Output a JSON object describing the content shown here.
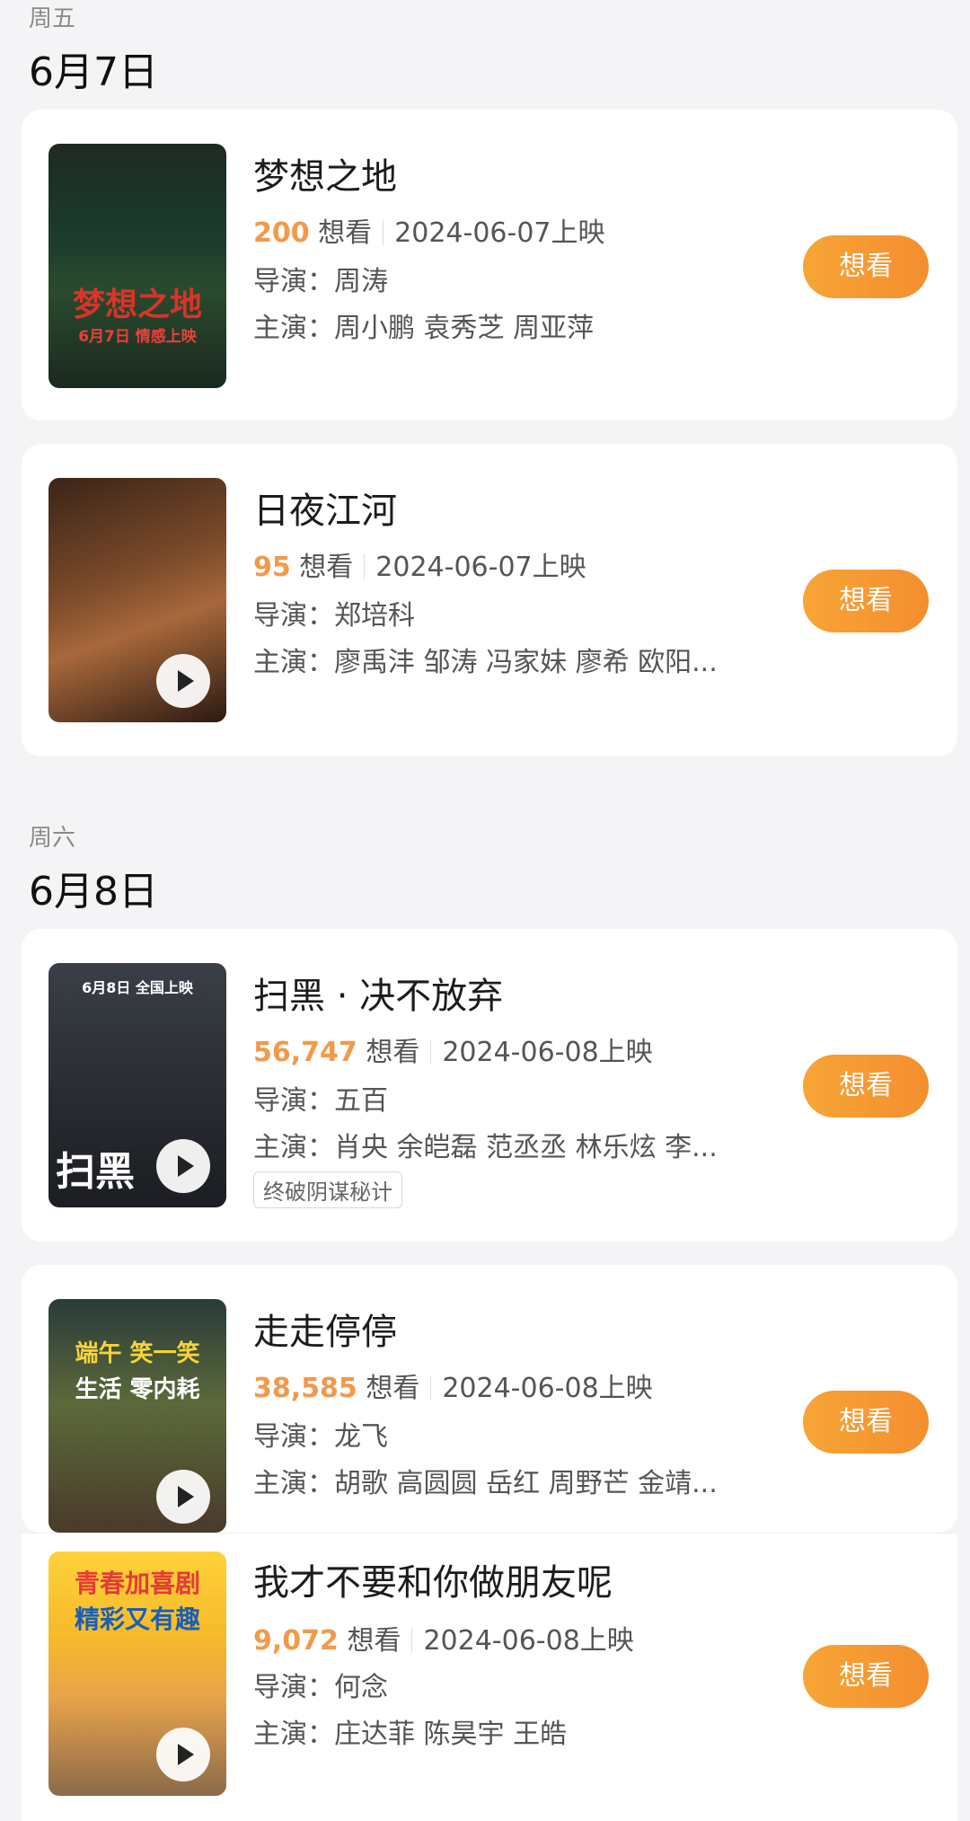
{
  "sections": [
    {
      "weekday": "周五",
      "date": "6月7日",
      "movies": [
        {
          "title": "梦想之地",
          "want_count": "200",
          "want_label": "想看",
          "release": "2024-06-07上映",
          "director": "导演：周涛",
          "cast": "主演：周小鹏 袁秀芝 周亚萍",
          "button": "想看",
          "poster_text": "梦想之地",
          "poster_sub": "6月7日 情感上映"
        },
        {
          "title": "日夜江河",
          "want_count": "95",
          "want_label": "想看",
          "release": "2024-06-07上映",
          "director": "导演：郑培科",
          "cast": "主演：廖禹沣 邹涛 冯家妹 廖希 欧阳...",
          "button": "想看"
        }
      ]
    },
    {
      "weekday": "周六",
      "date": "6月8日",
      "movies": [
        {
          "title": "扫黑 · 决不放弃",
          "want_count": "56,747",
          "want_label": "想看",
          "release": "2024-06-08上映",
          "director": "导演：五百",
          "cast": "主演：肖央 余皑磊 范丞丞 林乐炫 李...",
          "tag": "终破阴谋秘计",
          "button": "想看",
          "poster_text": "扫黑",
          "poster_sub": "6月8日 全国上映"
        },
        {
          "title": "走走停停",
          "want_count": "38,585",
          "want_label": "想看",
          "release": "2024-06-08上映",
          "director": "导演：龙飞",
          "cast": "主演：胡歌 高圆圆 岳红 周野芒 金靖...",
          "button": "想看",
          "poster_text": "端午 笑一笑",
          "poster_sub": "生活 零内耗"
        },
        {
          "title": "我才不要和你做朋友呢",
          "want_count": "9,072",
          "want_label": "想看",
          "release": "2024-06-08上映",
          "director": "导演：何念",
          "cast": "主演：庄达菲 陈昊宇 王皓",
          "button": "想看",
          "poster_text": "青春加喜剧",
          "poster_sub": "精彩又有趣"
        }
      ]
    }
  ],
  "colors": {
    "accent": "#f2994a",
    "button_gradient": [
      "#f7a536",
      "#f48e2f"
    ],
    "background": "#f4f4f6"
  },
  "icons": [
    "play-icon"
  ]
}
